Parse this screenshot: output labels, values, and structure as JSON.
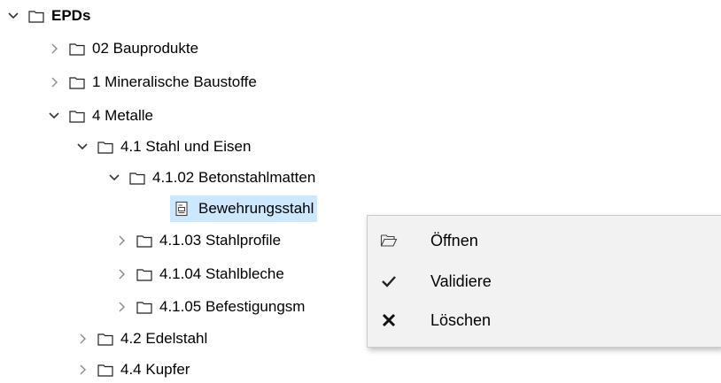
{
  "tree": {
    "root": {
      "label": "EPDs"
    },
    "items": [
      {
        "label": "02 Bauprodukte"
      },
      {
        "label": "1 Mineralische Baustoffe"
      },
      {
        "label": "4 Metalle"
      },
      {
        "label": "4.1 Stahl und Eisen"
      },
      {
        "label": "4.1.02 Betonstahlmatten"
      },
      {
        "label": "Bewehrungsstahl"
      },
      {
        "label": "4.1.03 Stahlprofile"
      },
      {
        "label": "4.1.04 Stahlbleche"
      },
      {
        "label": "4.1.05 Befestigungsm"
      },
      {
        "label": "4.2 Edelstahl"
      },
      {
        "label": "4.4 Kupfer"
      }
    ]
  },
  "context_menu": {
    "items": [
      {
        "label": "Öffnen",
        "icon": "folder-open-icon"
      },
      {
        "label": "Validiere",
        "icon": "checkmark-icon"
      },
      {
        "label": "Löschen",
        "icon": "delete-x-icon"
      }
    ]
  },
  "colors": {
    "selection": "#cce8ff",
    "menu_bg": "#f2f2f2",
    "arrow": "#6e6e6e"
  }
}
